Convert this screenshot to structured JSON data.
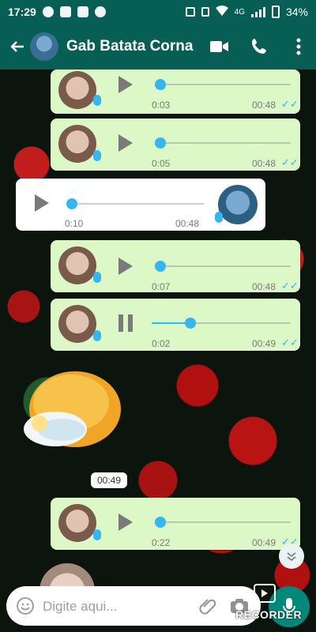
{
  "status_bar": {
    "time": "17:29",
    "network": "4G",
    "battery": "34%"
  },
  "header": {
    "back_icon": "arrow-back-icon",
    "contact_name": "Gab Batata Corna"
  },
  "messages": [
    {
      "direction": "out",
      "elapsed": "0:03",
      "time": "00:48",
      "progress": 0.0,
      "state": "paused"
    },
    {
      "direction": "out",
      "elapsed": "0:05",
      "time": "00:48",
      "progress": 0.0,
      "state": "paused"
    },
    {
      "direction": "in",
      "elapsed": "0:10",
      "time": "00:48",
      "progress": 0.0,
      "state": "paused"
    },
    {
      "direction": "out",
      "elapsed": "0:07",
      "time": "00:48",
      "progress": 0.0,
      "state": "paused"
    },
    {
      "direction": "out",
      "elapsed": "0:02",
      "time": "00:49",
      "progress": 0.28,
      "state": "playing"
    },
    {
      "direction": "out",
      "elapsed": "0:22",
      "time": "00:49",
      "progress": 0.0,
      "state": "paused"
    }
  ],
  "sticker_time": "00:49",
  "input": {
    "placeholder": "Digite aqui..."
  },
  "watermark": {
    "label": "RECORDER"
  },
  "colors": {
    "header": "#075e54",
    "outgoing": "#dcf8c6",
    "accent": "#34b7f1",
    "fab": "#00897b"
  }
}
